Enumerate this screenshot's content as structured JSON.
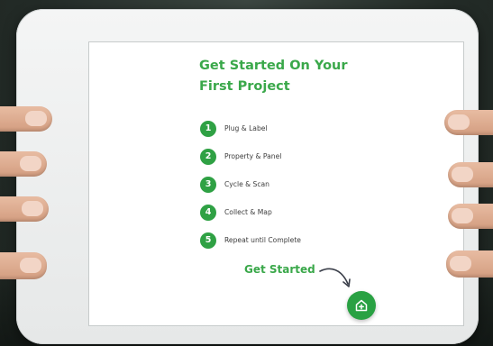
{
  "screen": {
    "title_line1": "Get Started On Your",
    "title_line2": "First Project",
    "steps": [
      {
        "num": "1",
        "label": "Plug & Label"
      },
      {
        "num": "2",
        "label": "Property & Panel"
      },
      {
        "num": "3",
        "label": "Cycle & Scan"
      },
      {
        "num": "4",
        "label": "Collect & Map"
      },
      {
        "num": "5",
        "label": "Repeat until Complete"
      }
    ],
    "cta_label": "Get Started",
    "fab_icon": "home-plus-icon"
  },
  "colors": {
    "accent": "#3aa84a",
    "badge": "#2fa144",
    "fab": "#29a143"
  }
}
